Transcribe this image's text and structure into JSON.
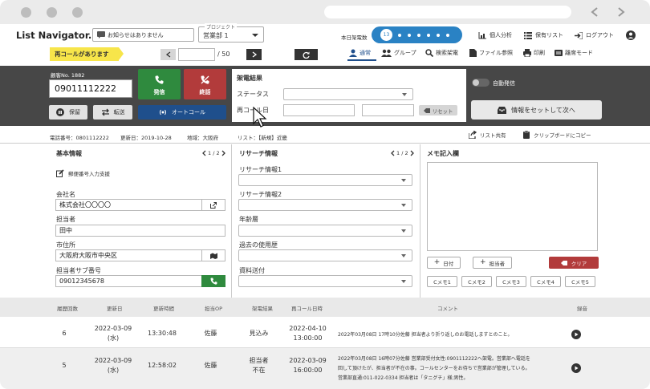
{
  "header": {
    "logo": "List Navigator.",
    "notice": "お知らせはありません",
    "project_label": "プロジェクト",
    "project_value": "営業部 1",
    "today_calls_label": "本日架電数",
    "today_calls_value": "13",
    "nav": [
      "個人分析",
      "保有リスト",
      "ログアウト"
    ]
  },
  "toolbar": {
    "recall_badge": "再コールがあります",
    "page_value": "",
    "page_total": "/ 50",
    "tabs": [
      "通常",
      "グループ",
      "検索架電",
      "ファイル参照",
      "印刷",
      "離席モード"
    ]
  },
  "call_panel": {
    "customer_no": "顧客No. 1882",
    "phone": "09011112222",
    "call_btn": "発信",
    "end_btn": "終話",
    "hold_btn": "保留",
    "transfer_btn": "転送",
    "auto_call_btn": "オートコール"
  },
  "result_panel": {
    "title": "架電結果",
    "status_label": "ステータス",
    "recall_label": "再コール日",
    "reset_btn": "リセット",
    "auto_send_label": "自動発信",
    "next_btn": "情報をセットして次へ"
  },
  "info_bar": {
    "phone": "電話番号：0801112222",
    "updated": "更新日：2019-10-28",
    "area": "地域：大阪府",
    "list": "リスト：【新規】近畿",
    "share": "リスト共有",
    "copy": "クリップボードにコピー"
  },
  "basic": {
    "title": "基本情報",
    "page": "1 / 2",
    "postal_btn": "郵便番号入力支援",
    "company_label": "会社名",
    "company_value": "株式会社〇〇〇〇",
    "person_label": "担当者",
    "person_value": "田中",
    "address_label": "市住所",
    "address_value": "大阪府大阪市中央区",
    "subphone_label": "担当者サブ番号",
    "subphone_value": "09012345678"
  },
  "research": {
    "title": "リサーチ情報",
    "page": "1 / 2",
    "fields": [
      "リサーチ情報1",
      "リサーチ情報2",
      "年齢層",
      "過去の使用歴",
      "資料送付"
    ]
  },
  "memo": {
    "title": "メモ記入欄",
    "date_btn": "日付",
    "person_btn": "担当者",
    "clear_btn": "クリア",
    "memo_btns": [
      "Cメモ1",
      "Cメモ2",
      "Cメモ3",
      "Cメモ4",
      "Cメモ5"
    ]
  },
  "history": {
    "columns": [
      "履歴回数",
      "更新日",
      "更新時間",
      "担当OP",
      "架電結果",
      "再コール日時",
      "コメント",
      "録音"
    ],
    "rows": [
      {
        "count": "6",
        "date": "2022-03-09",
        "dow": "(水)",
        "time": "13:30:48",
        "op": "佐藤",
        "result1": "見込み",
        "result2": "",
        "recall_date": "2022-04-10",
        "recall_time": "13:00:00",
        "comment": [
          "2022年03月08日 17時10分佐藤 担当者より折り返しのお電話しますとのこと。"
        ]
      },
      {
        "count": "5",
        "date": "2022-03-09",
        "dow": "(水)",
        "time": "12:58:02",
        "op": "佐藤",
        "result1": "担当者",
        "result2": "不在",
        "recall_date": "2022-03-09",
        "recall_time": "16:00:00",
        "comment": [
          "2022年03月08日 16時07分佐藤 営業部受付女性:0901112222へ架電。営業部へ電話を",
          "回して頂けたが、担当者が不在の事。コールセンターをお待ちで営業部が管理している。",
          "営業部直通:011-022-0334 担当者は「タニグチ」様;男性。"
        ]
      }
    ]
  },
  "colors": {
    "accent": "#2a82c4",
    "dark_panel": "#474747",
    "green": "#2f8a3e",
    "red": "#b23b3b",
    "blue": "#1f4f8c",
    "yellow": "#f7e54a"
  }
}
